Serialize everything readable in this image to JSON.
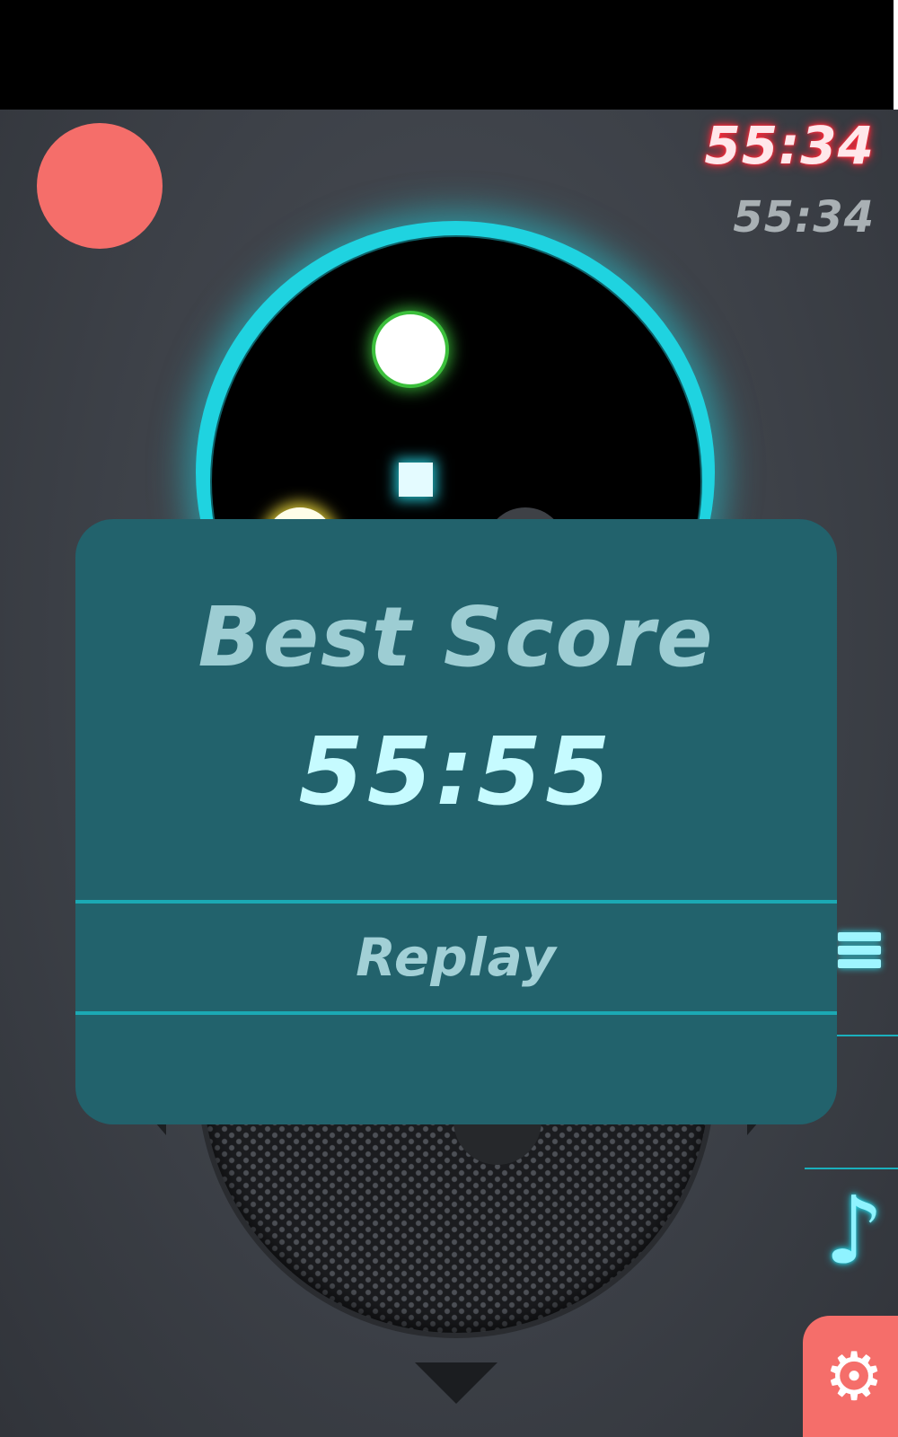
{
  "hud": {
    "current_time": "55:34",
    "best_time": "55:34"
  },
  "modal": {
    "title": "Best Score",
    "score": "55:55",
    "replay_label": "Replay"
  },
  "icons": {
    "music": "♪",
    "settings": "⚙",
    "menu": "menu-icon"
  },
  "colors": {
    "accent_cyan": "#1fd3e0",
    "record_red": "#f56e6a",
    "modal_bg": "#22626c",
    "timer_glow": "#ff2a3a"
  }
}
